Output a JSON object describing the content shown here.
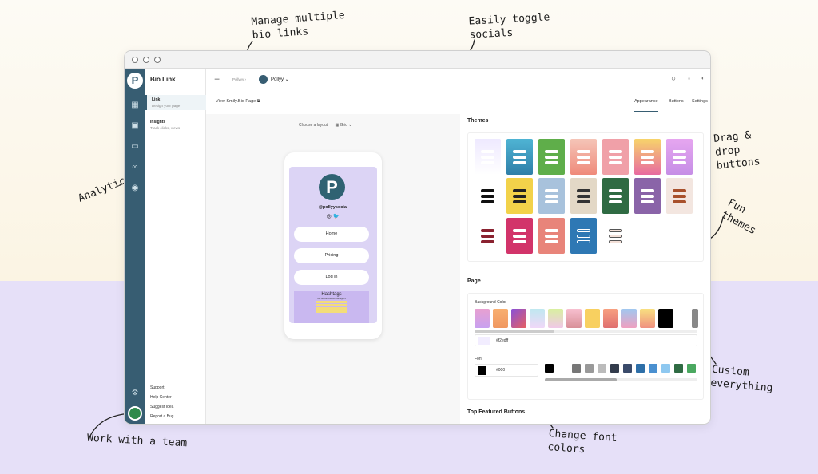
{
  "annotations": {
    "manage": "Manage multiple\nbio links",
    "toggle": "Easily toggle\nsocials",
    "analytics": "Analytics",
    "drag": "Drag &\ndrop\nbuttons",
    "themes": "Fun\nthemes",
    "custom": "Custom\neverything",
    "team": "Work with a team",
    "font": "Change font\ncolors"
  },
  "app": {
    "name": "Bio Link",
    "logo_letter": "P"
  },
  "sidebar": {
    "items": [
      {
        "label": "Link",
        "sub": "Design your page"
      },
      {
        "label": "Insights",
        "sub": "Track clicks, views"
      }
    ],
    "footer": [
      "Support",
      "Help Center",
      "Suggest Idea",
      "Report a Bug"
    ]
  },
  "topbar": {
    "menu_icon": "☰",
    "breadcrumb": "Pollyyy ›",
    "profile_name": "Pollyy ⌄"
  },
  "subbar": {
    "view_link": "View Smily.Bio Page ⧉",
    "tabs": [
      "Appearance",
      "Buttons",
      "Settings"
    ]
  },
  "editor": {
    "layout_label": "Choose a layout",
    "layout_value": "▦ Grid ⌄"
  },
  "preview": {
    "logo_letter": "P",
    "handle": "@pollyysocial",
    "socials": "◎ 🐦",
    "buttons": [
      "Home",
      "Pricing",
      "Log in"
    ],
    "tags_title": "Hashtags",
    "tags_sub": "for Social Media Managers"
  },
  "themes_section": {
    "title": "Themes"
  },
  "page_section": {
    "title": "Page",
    "bg_label": "Background Color",
    "bg_hex": "#f2edff",
    "font_label": "Font",
    "font_hex": "#000"
  },
  "featured": {
    "title": "Top Featured Buttons"
  },
  "colors": {
    "accent": "#375d72",
    "page_bg": "#f2edff"
  }
}
